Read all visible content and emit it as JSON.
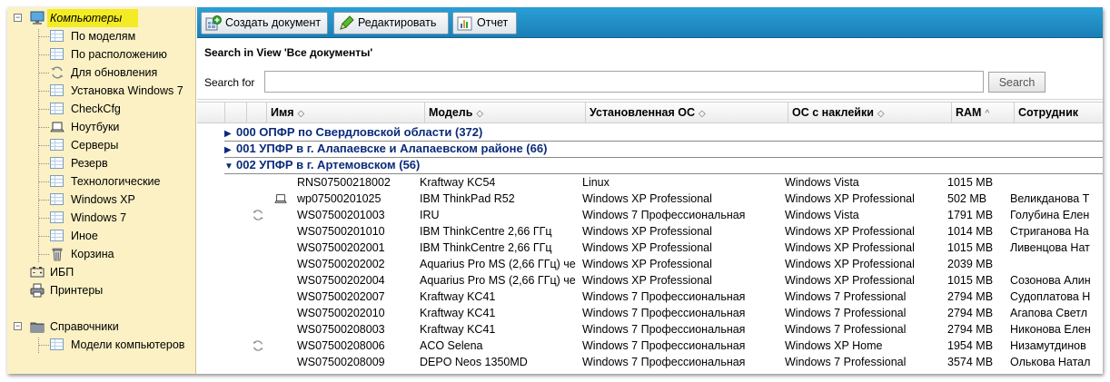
{
  "sidebar": {
    "items": [
      {
        "label": "Компьютеры",
        "icon": "monitor-icon",
        "selected": true
      },
      {
        "label": "По моделям",
        "icon": "grid-icon"
      },
      {
        "label": "По расположению",
        "icon": "grid-icon"
      },
      {
        "label": "Для обновления",
        "icon": "refresh-icon"
      },
      {
        "label": "Установка Windows 7",
        "icon": "grid-icon"
      },
      {
        "label": "CheckCfg",
        "icon": "grid-icon"
      },
      {
        "label": "Ноутбуки",
        "icon": "laptop-icon"
      },
      {
        "label": "Серверы",
        "icon": "grid-icon"
      },
      {
        "label": "Резерв",
        "icon": "grid-icon"
      },
      {
        "label": "Технологические",
        "icon": "grid-icon"
      },
      {
        "label": "Windows XP",
        "icon": "grid-icon"
      },
      {
        "label": "Windows 7",
        "icon": "grid-icon"
      },
      {
        "label": "Иное",
        "icon": "grid-icon"
      },
      {
        "label": "Корзина",
        "icon": "trash-icon"
      },
      {
        "label": "ИБП",
        "icon": "battery-icon"
      },
      {
        "label": "Принтеры",
        "icon": "printer-icon"
      },
      {
        "label": "Справочники",
        "icon": "folder-icon"
      },
      {
        "label": "Модели компьютеров",
        "icon": "grid-icon"
      }
    ]
  },
  "toolbar": {
    "create_label": "Создать документ",
    "edit_label": "Редактировать",
    "report_label": "Отчет"
  },
  "search": {
    "title": "Search in View 'Все документы'",
    "label": "Search for",
    "value": "",
    "button": "Search"
  },
  "grid": {
    "columns": [
      "Имя",
      "Модель",
      "Установленная ОС",
      "ОС с наклейки",
      "RAM",
      "Сотрудник"
    ],
    "sort_marks": [
      "◇",
      "◇",
      "◇",
      "◇",
      "^",
      ""
    ],
    "groups": [
      {
        "label": "000 ОПФР по Свердловской области (372)",
        "expanded": false
      },
      {
        "label": "001 УПФР в г. Алапаевске и Алапаевском районе (66)",
        "expanded": false
      },
      {
        "label": "002 УПФР в г. Артемовском (56)",
        "expanded": true
      }
    ],
    "rows": [
      {
        "icon": "",
        "name": "RNS07500218002",
        "model": "Kraftway KC54",
        "os": "Linux",
        "os_sticker": "Windows Vista",
        "ram": "1015 MB",
        "employee": ""
      },
      {
        "icon": "laptop-icon",
        "name": "wp07500201025",
        "model": "IBM ThinkPad R52",
        "os": "Windows XP Professional",
        "os_sticker": "Windows XP Professional",
        "ram": "502 MB",
        "employee": "Великданова Т"
      },
      {
        "icon": "refresh-icon",
        "name": "WS07500201003",
        "model": "IRU",
        "os": "Windows 7 Профессиональная",
        "os_sticker": "Windows Vista",
        "ram": "1791 MB",
        "employee": "Голубина Елен"
      },
      {
        "icon": "",
        "name": "WS07500201010",
        "model": "IBM ThinkCentre 2,66 ГГц",
        "os": "Windows XP Professional",
        "os_sticker": "Windows XP Professional",
        "ram": "1014 MB",
        "employee": "Стриганова На"
      },
      {
        "icon": "",
        "name": "WS07500202001",
        "model": "IBM ThinkCentre 2,66 ГГц",
        "os": "Windows XP Professional",
        "os_sticker": "Windows XP Professional",
        "ram": "1015 MB",
        "employee": "Ливенцова Нат"
      },
      {
        "icon": "",
        "name": "WS07500202002",
        "model": "Aquarius Pro MS (2,66 ГГц) че",
        "os": "Windows XP Professional",
        "os_sticker": "Windows XP Professional",
        "ram": "2039 MB",
        "employee": ""
      },
      {
        "icon": "",
        "name": "WS07500202004",
        "model": "Aquarius Pro MS (2,66 ГГц) че",
        "os": "Windows XP Professional",
        "os_sticker": "Windows XP Professional",
        "ram": "1015 MB",
        "employee": "Созонова Алин"
      },
      {
        "icon": "",
        "name": "WS07500202007",
        "model": "Kraftway KC41",
        "os": "Windows 7 Профессиональная",
        "os_sticker": "Windows 7 Professional",
        "ram": "2794 MB",
        "employee": "Судоплатова Н"
      },
      {
        "icon": "",
        "name": "WS07500202010",
        "model": "Kraftway KC41",
        "os": "Windows 7 Профессиональная",
        "os_sticker": "Windows 7 Professional",
        "ram": "2794 MB",
        "employee": "Агапова Светл"
      },
      {
        "icon": "",
        "name": "WS07500208003",
        "model": "Kraftway KC41",
        "os": "Windows 7 Профессиональная",
        "os_sticker": "Windows 7 Professional",
        "ram": "2794 MB",
        "employee": "Никонова Елен"
      },
      {
        "icon": "refresh-icon",
        "name": "WS07500208006",
        "model": "ACO Selena",
        "os": "Windows 7 Профессиональная",
        "os_sticker": "Windows XP Home",
        "ram": "1954 MB",
        "employee": "Низамутдинов"
      },
      {
        "icon": "",
        "name": "WS07500208009",
        "model": "DEPO Neos 1350MD",
        "os": "Windows 7 Профессиональная",
        "os_sticker": "Windows 7 Professional",
        "ram": "3574 MB",
        "employee": "Олькова Натал"
      }
    ]
  },
  "colors": {
    "toolbar": "#1f8fc8",
    "sidebar_bg": "#fbf1c4",
    "selected_bg": "#f3ec24",
    "group_text": "#0b2a7a"
  }
}
